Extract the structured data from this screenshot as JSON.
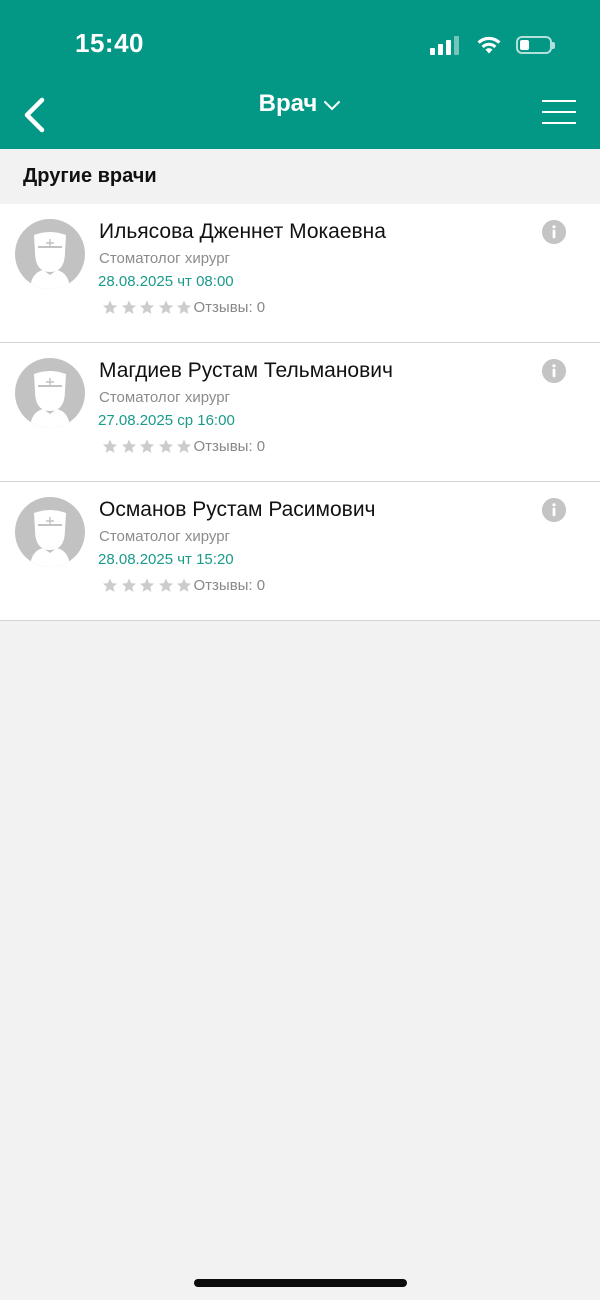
{
  "status_bar": {
    "time": "15:40"
  },
  "header": {
    "title": "Врач",
    "color": "#029885"
  },
  "section": {
    "title": "Другие врачи"
  },
  "doctors": [
    {
      "name": "Ильясова Дженнет Мокаевна",
      "specialty": "Стоматолог хирург",
      "next_slot": "28.08.2025 чт 08:00",
      "reviews": "Отзывы: 0"
    },
    {
      "name": "Магдиев Рустам Тельманович",
      "specialty": "Стоматолог хирург",
      "next_slot": "27.08.2025 ср 16:00",
      "reviews": "Отзывы: 0"
    },
    {
      "name": "Османов Рустам Расимович",
      "specialty": "Стоматолог хирург",
      "next_slot": "28.08.2025 чт 15:20",
      "reviews": "Отзывы: 0"
    }
  ],
  "icons": {
    "back": "chevron-left-icon",
    "title_dropdown": "chevron-down-icon",
    "menu": "hamburger-menu-icon",
    "avatar": "doctor-avatar-icon",
    "info": "info-icon",
    "star": "star-icon"
  },
  "colors": {
    "accent": "#029885",
    "slot_text": "#1b9a8a",
    "avatar_bg": "#c2c2c2",
    "star": "#cccccc"
  }
}
